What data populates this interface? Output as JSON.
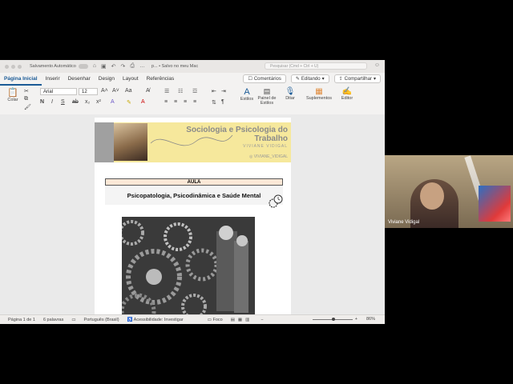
{
  "titlebar": {
    "autosave": "Salvamento Automático",
    "doc_name": "p... • Salvo no meu Mac",
    "search_placeholder": "Pesquisar (Cmd + Ctrl + U)"
  },
  "ribbon_tabs": [
    {
      "label": "Página Inicial"
    },
    {
      "label": "Inserir"
    },
    {
      "label": "Desenhar"
    },
    {
      "label": "Design"
    },
    {
      "label": "Layout"
    },
    {
      "label": "Referências"
    }
  ],
  "ribbon_actions": {
    "comments": "Comentários",
    "editing": "Editando",
    "share": "Compartilhar"
  },
  "ribbon": {
    "paste": "Colar",
    "font": "Arial",
    "size": "12",
    "styles": "Estilos",
    "styles_pane": "Painel de Estilos",
    "dictate": "Ditar",
    "addins": "Suplementos",
    "editor": "Editor"
  },
  "document": {
    "banner_title": "Sociologia e Psicologia do Trabalho",
    "banner_subtitle": "VIVIANE VIDIGAL",
    "banner_handle": "VIVIANE_VIDIGAL",
    "aula": "AULA",
    "subject": "Psicopatologia, Psicodinâmica e Saúde Mental"
  },
  "statusbar": {
    "page": "Página 1 de 1",
    "words": "6 palavras",
    "language": "Português (Brasil)",
    "accessibility": "Acessibilidade: Investigar",
    "focus": "Foco",
    "zoom": "86%"
  },
  "video": {
    "participant": "Viviane Vidigal"
  }
}
